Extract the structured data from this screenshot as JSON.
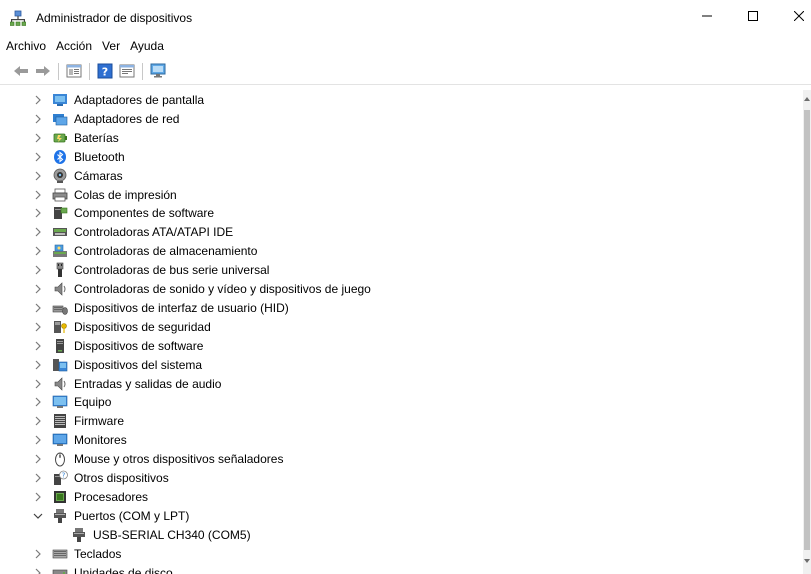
{
  "window": {
    "title": "Administrador de dispositivos",
    "icon": "device-manager-icon"
  },
  "menu": [
    "Archivo",
    "Acción",
    "Ver",
    "Ayuda"
  ],
  "toolbar": [
    "back-arrow-icon",
    "forward-arrow-icon",
    "properties-icon",
    "help-icon",
    "view-icon",
    "monitor-scan-icon"
  ],
  "tree": [
    {
      "label": "Adaptadores de pantalla",
      "icon": "display-adapter-icon",
      "expanded": false
    },
    {
      "label": "Adaptadores de red",
      "icon": "network-adapter-icon",
      "expanded": false
    },
    {
      "label": "Baterías",
      "icon": "battery-icon",
      "expanded": false
    },
    {
      "label": "Bluetooth",
      "icon": "bluetooth-icon",
      "expanded": false
    },
    {
      "label": "Cámaras",
      "icon": "camera-icon",
      "expanded": false
    },
    {
      "label": "Colas de impresión",
      "icon": "printer-icon",
      "expanded": false
    },
    {
      "label": "Componentes de software",
      "icon": "software-component-icon",
      "expanded": false
    },
    {
      "label": "Controladoras ATA/ATAPI IDE",
      "icon": "ide-controller-icon",
      "expanded": false
    },
    {
      "label": "Controladoras de almacenamiento",
      "icon": "storage-controller-icon",
      "expanded": false
    },
    {
      "label": "Controladoras de bus serie universal",
      "icon": "usb-icon",
      "expanded": false
    },
    {
      "label": "Controladoras de sonido y vídeo y dispositivos de juego",
      "icon": "speaker-icon",
      "expanded": false
    },
    {
      "label": "Dispositivos de interfaz de usuario (HID)",
      "icon": "hid-icon",
      "expanded": false
    },
    {
      "label": "Dispositivos de seguridad",
      "icon": "security-device-icon",
      "expanded": false
    },
    {
      "label": "Dispositivos de software",
      "icon": "software-device-icon",
      "expanded": false
    },
    {
      "label": "Dispositivos del sistema",
      "icon": "system-device-icon",
      "expanded": false
    },
    {
      "label": "Entradas y salidas de audio",
      "icon": "audio-io-icon",
      "expanded": false
    },
    {
      "label": "Equipo",
      "icon": "computer-icon",
      "expanded": false
    },
    {
      "label": "Firmware",
      "icon": "firmware-icon",
      "expanded": false
    },
    {
      "label": "Monitores",
      "icon": "monitor-icon",
      "expanded": false
    },
    {
      "label": "Mouse y otros dispositivos señaladores",
      "icon": "mouse-icon",
      "expanded": false
    },
    {
      "label": "Otros dispositivos",
      "icon": "unknown-device-icon",
      "expanded": false
    },
    {
      "label": "Procesadores",
      "icon": "processor-icon",
      "expanded": false
    },
    {
      "label": "Puertos (COM y LPT)",
      "icon": "port-icon",
      "expanded": true,
      "children": [
        {
          "label": "USB-SERIAL CH340 (COM5)",
          "icon": "port-icon"
        }
      ]
    },
    {
      "label": "Teclados",
      "icon": "keyboard-icon",
      "expanded": false
    },
    {
      "label": "Unidades de disco",
      "icon": "disk-drive-icon",
      "expanded": false
    }
  ]
}
